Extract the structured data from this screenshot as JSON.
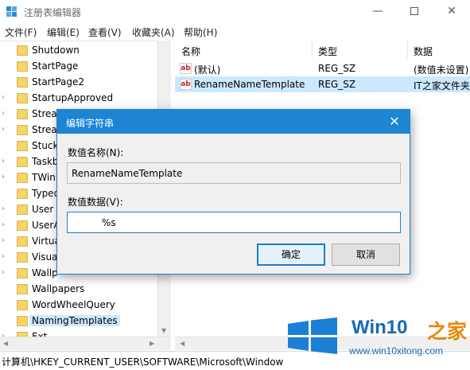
{
  "window": {
    "title": "注册表编辑器",
    "minimize_glyph": "—",
    "close_glyph": "✕"
  },
  "menu": [
    "文件(F)",
    "编辑(E)",
    "查看(V)",
    "收藏夹(A)",
    "帮助(H)"
  ],
  "tree": {
    "items": [
      {
        "label": "Shutdown",
        "expander": ""
      },
      {
        "label": "StartPage",
        "expander": ""
      },
      {
        "label": "StartPage2",
        "expander": ""
      },
      {
        "label": "StartupApproved",
        "expander": "›"
      },
      {
        "label": "Stream",
        "expander": "›"
      },
      {
        "label": "Stream",
        "expander": "›"
      },
      {
        "label": "Stuck",
        "expander": ""
      },
      {
        "label": "Taskb",
        "expander": "›"
      },
      {
        "label": "TWinU",
        "expander": "›"
      },
      {
        "label": "Typed",
        "expander": ""
      },
      {
        "label": "User",
        "expander": "›"
      },
      {
        "label": "UserA",
        "expander": "›"
      },
      {
        "label": "Virtua",
        "expander": "›"
      },
      {
        "label": "Visua",
        "expander": "›"
      },
      {
        "label": "Wallp",
        "expander": "›"
      },
      {
        "label": "Wallpapers",
        "expander": ""
      },
      {
        "label": "WordWheelQuery",
        "expander": ""
      },
      {
        "label": "NamingTemplates",
        "expander": "",
        "selected": true
      },
      {
        "label": "Ext",
        "expander": "›"
      }
    ]
  },
  "values_table": {
    "columns": [
      "名称",
      "类型",
      "数据"
    ],
    "rows": [
      {
        "icon": "ab",
        "name": "(默认)",
        "type": "REG_SZ",
        "data": "(数值未设置)",
        "selected": false
      },
      {
        "icon": "ab",
        "name": "RenameNameTemplate",
        "type": "REG_SZ",
        "data": "IT之家文件夹",
        "selected": true
      }
    ]
  },
  "status": {
    "path": "计算机\\HKEY_CURRENT_USER\\SOFTWARE\\Microsoft\\Windows"
  },
  "dialog": {
    "title": "编辑字符串",
    "close_glyph": "✕",
    "name_label": "数值名称(N):",
    "name_value": "RenameNameTemplate",
    "data_label": "数值数据(V):",
    "data_value": "%s",
    "ok_label": "确定",
    "cancel_label": "取消"
  },
  "watermark": {
    "brand": "Win10",
    "zhi": "之家",
    "url": "www.win10xitong.com"
  },
  "colors": {
    "accent": "#1e84d4",
    "selection": "#cce8ff",
    "folder": "#f6d36b"
  }
}
